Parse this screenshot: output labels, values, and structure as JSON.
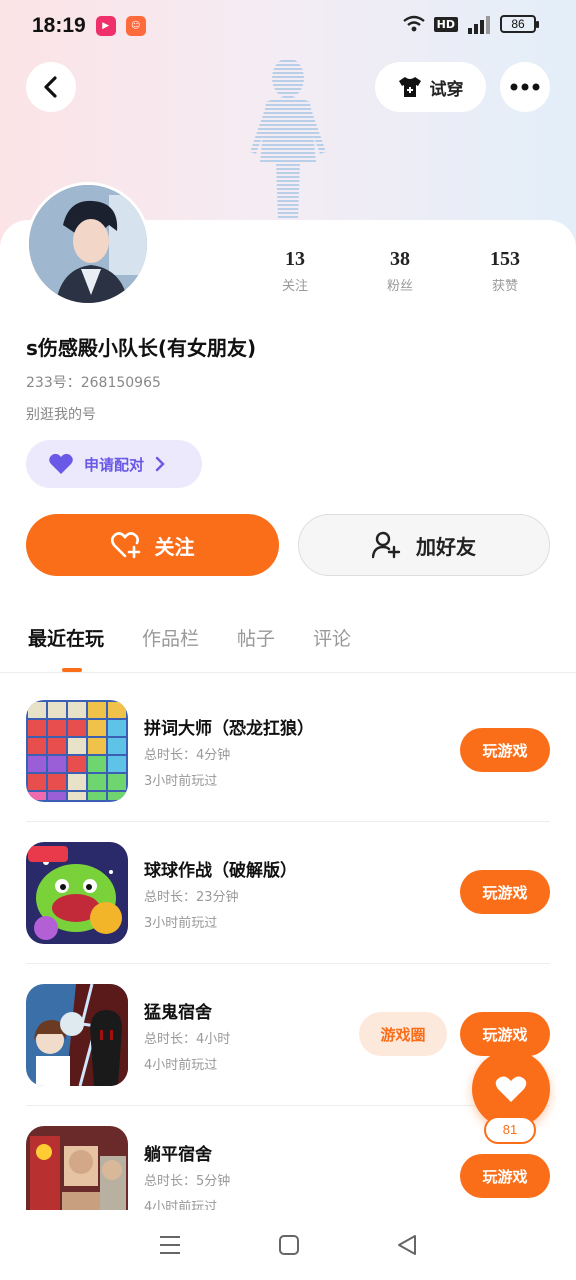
{
  "status_bar": {
    "time": "18:19",
    "battery": "86"
  },
  "header": {
    "tryon_label": "试穿"
  },
  "profile": {
    "username": "s伤感殿小队长(有女朋友)",
    "id_label": "233号：",
    "id_value": "268150965",
    "bio": "别逛我的号",
    "match_label": "申请配对"
  },
  "stats": [
    {
      "value": "13",
      "label": "关注"
    },
    {
      "value": "38",
      "label": "粉丝"
    },
    {
      "value": "153",
      "label": "获赞"
    }
  ],
  "actions": {
    "follow": "关注",
    "add_friend": "加好友"
  },
  "tabs": [
    "最近在玩",
    "作品栏",
    "帖子",
    "评论"
  ],
  "games": [
    {
      "title": "拼词大师（恐龙扛狼）",
      "duration": "总时长：4分钟",
      "ago": "3小时前玩过",
      "play": "玩游戏"
    },
    {
      "title": "球球作战（破解版）",
      "duration": "总时长：23分钟",
      "ago": "3小时前玩过",
      "play": "玩游戏"
    },
    {
      "title": "猛鬼宿舍",
      "duration": "总时长：4小时",
      "ago": "4小时前玩过",
      "play": "玩游戏",
      "circle": "游戏圈"
    },
    {
      "title": "躺平宿舍",
      "duration": "总时长：5分钟",
      "ago": "4小时前玩过",
      "play": "玩游戏"
    }
  ],
  "like_count": "81",
  "colors": {
    "accent": "#fa6e1a",
    "match": "#6a58e6"
  }
}
